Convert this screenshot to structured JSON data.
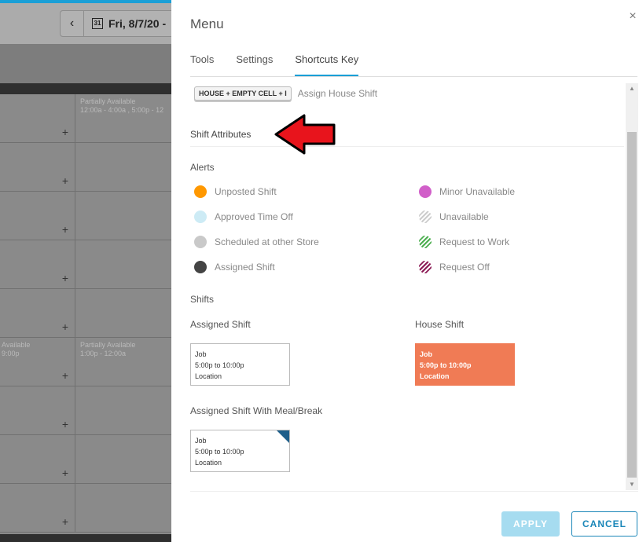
{
  "background": {
    "date": "Fri, 8/7/20 -",
    "calendar_day": "31",
    "nav_prev": "‹",
    "availability": [
      {
        "title": "Partially Available",
        "hours": "12:00a - 4:00a , 5:00p - 12"
      },
      {
        "title": "Available",
        "hours": "9:00p"
      },
      {
        "title": "Partially Available",
        "hours": "1:00p - 12:00a"
      }
    ],
    "plus": "+"
  },
  "menu": {
    "title": "Menu",
    "close": "×",
    "tabs": [
      {
        "label": "Tools"
      },
      {
        "label": "Settings"
      },
      {
        "label": "Shortcuts Key"
      }
    ],
    "active_tab": "Shortcuts Key",
    "shortcut": {
      "keys": "HOUSE + EMPTY CELL + I",
      "description": "Assign House Shift"
    },
    "shift_attributes_title": "Shift Attributes",
    "alerts_title": "Alerts",
    "alerts": [
      {
        "label": "Unposted Shift",
        "color": "#ff9800"
      },
      {
        "label": "Approved Time Off",
        "color": "#cdebf5"
      },
      {
        "label": "Scheduled at other Store",
        "color": "#c9c9c9"
      },
      {
        "label": "Assigned Shift",
        "color": "#444444"
      },
      {
        "label": "Minor Unavailable",
        "color": "#d15fc9"
      },
      {
        "label": "Unavailable",
        "color": "#cccccc"
      },
      {
        "label": "Request to Work",
        "color": "#4caf50"
      },
      {
        "label": "Request Off",
        "color": "#8b1a55"
      }
    ],
    "shifts_title": "Shifts",
    "shifts": {
      "assigned": {
        "title": "Assigned Shift",
        "job": "Job",
        "time": "5:00p to 10:00p",
        "location": "Location"
      },
      "house": {
        "title": "House Shift",
        "job": "Job",
        "time": "5:00p to 10:00p",
        "location": "Location",
        "color": "#f07b55"
      },
      "meal": {
        "title": "Assigned Shift With Meal/Break",
        "job": "Job",
        "time": "5:00p to 10:00p",
        "location": "Location"
      }
    },
    "buttons": {
      "apply": "APPLY",
      "cancel": "CANCEL"
    },
    "scroll_up": "▲",
    "scroll_down": "▼"
  },
  "accent_color": "#1a9fd6"
}
